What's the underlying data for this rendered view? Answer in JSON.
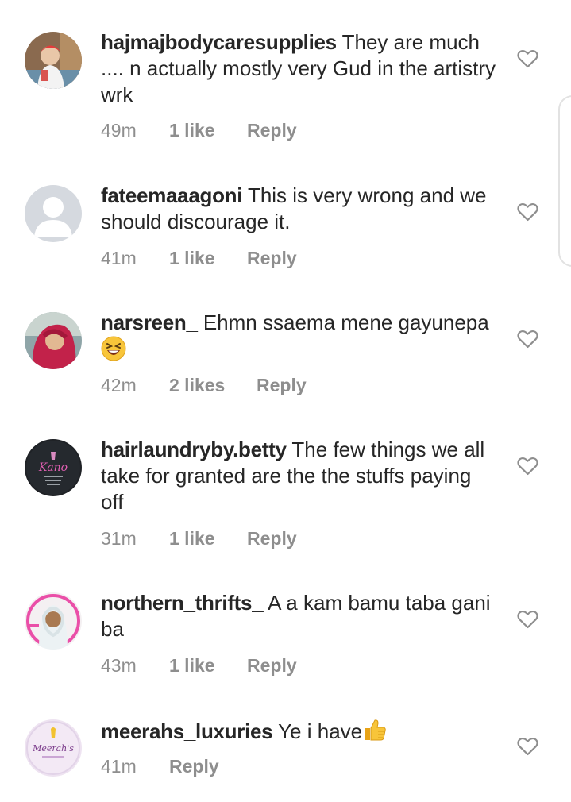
{
  "comments": [
    {
      "username": "hajmajbodycaresupplies",
      "text": "They are much .... n actually mostly very Gud in the artistry wrk",
      "time": "49m",
      "likes": "1 like",
      "reply": "Reply"
    },
    {
      "username": "fateemaaagoni",
      "text": "This is very wrong and we should discourage it.",
      "time": "41m",
      "likes": "1 like",
      "reply": "Reply"
    },
    {
      "username": "narsreen_",
      "text": "Ehmn ssaema mene gayunepa",
      "emoji": "grinning-squinting-face",
      "time": "42m",
      "likes": "2 likes",
      "reply": "Reply"
    },
    {
      "username": "hairlaundryby.betty",
      "text": "The few things we all take for granted are the the stuffs paying off",
      "time": "31m",
      "likes": "1 like",
      "reply": "Reply"
    },
    {
      "username": "northern_thrifts_",
      "text": "A a kam bamu taba gani ba",
      "time": "43m",
      "likes": "1 like",
      "reply": "Reply"
    },
    {
      "username": "meerahs_luxuries",
      "text": "Ye i have",
      "emoji": "thumbs-up",
      "time": "41m",
      "reply": "Reply"
    }
  ],
  "avatar_logos": {
    "hairlaundryby_betty": "Kano",
    "meerahs_luxuries": "Meerah's"
  },
  "colors": {
    "text": "#262626",
    "meta": "#8e8e8e",
    "heart": "#8e8e8e"
  }
}
